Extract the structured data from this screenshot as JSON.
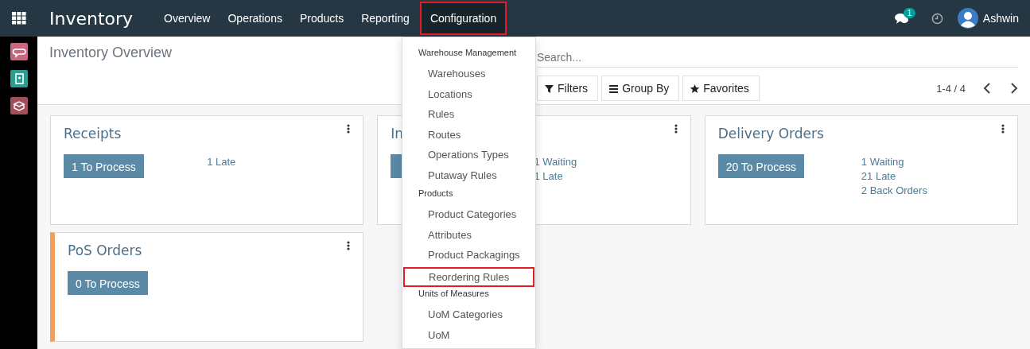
{
  "app": {
    "name": "Inventory"
  },
  "nav": [
    {
      "label": "Overview",
      "selected": false,
      "highlighted": false
    },
    {
      "label": "Operations",
      "selected": false,
      "highlighted": false
    },
    {
      "label": "Products",
      "selected": false,
      "highlighted": false
    },
    {
      "label": "Reporting",
      "selected": false,
      "highlighted": false
    },
    {
      "label": "Configuration",
      "selected": true,
      "highlighted": true
    }
  ],
  "systray": {
    "message_count": "1",
    "user": "Ashwin"
  },
  "sidebar": [
    {
      "kind": "chat",
      "color": "#c9677f"
    },
    {
      "kind": "contacts",
      "color": "#2e9b91"
    },
    {
      "kind": "box",
      "color": "#a34e5a"
    }
  ],
  "breadcrumb": "Inventory Overview",
  "search": {
    "placeholder": "Search..."
  },
  "filters": [
    {
      "label": "Filters",
      "kind": "filter"
    },
    {
      "label": "Group By",
      "kind": "bars"
    },
    {
      "label": "Favorites",
      "kind": "star"
    }
  ],
  "pager": {
    "value": "1-4 / 4"
  },
  "cards": [
    {
      "title": "Receipts",
      "button": "1 To Process",
      "stats": [
        "1 Late"
      ]
    },
    {
      "title": "In",
      "stats": [
        "1 Waiting",
        "1 Late"
      ]
    },
    {
      "title": "Delivery Orders",
      "button": "20 To Process",
      "stats": [
        "1 Waiting",
        "21 Late",
        "2 Back Orders"
      ]
    },
    {
      "title": "PoS Orders",
      "button": "0 To Process",
      "color": "#f0a05a"
    }
  ],
  "menu": {
    "sections": [
      {
        "title": "Warehouse Management",
        "items": [
          {
            "label": "Warehouses",
            "highlighted": false
          },
          {
            "label": "Locations",
            "highlighted": false
          },
          {
            "label": "Rules",
            "highlighted": false
          },
          {
            "label": "Routes",
            "highlighted": false
          },
          {
            "label": "Operations Types",
            "highlighted": false
          },
          {
            "label": "Putaway Rules",
            "highlighted": false
          }
        ]
      },
      {
        "title": "Products",
        "items": [
          {
            "label": "Product Categories",
            "highlighted": false
          },
          {
            "label": "Attributes",
            "highlighted": false
          },
          {
            "label": "Product Packagings",
            "highlighted": false
          },
          {
            "label": "Reordering Rules",
            "highlighted": true
          }
        ]
      },
      {
        "title": "Units of Measures",
        "items": [
          {
            "label": "UoM Categories",
            "highlighted": false
          },
          {
            "label": "UoM",
            "highlighted": false
          }
        ]
      }
    ]
  }
}
